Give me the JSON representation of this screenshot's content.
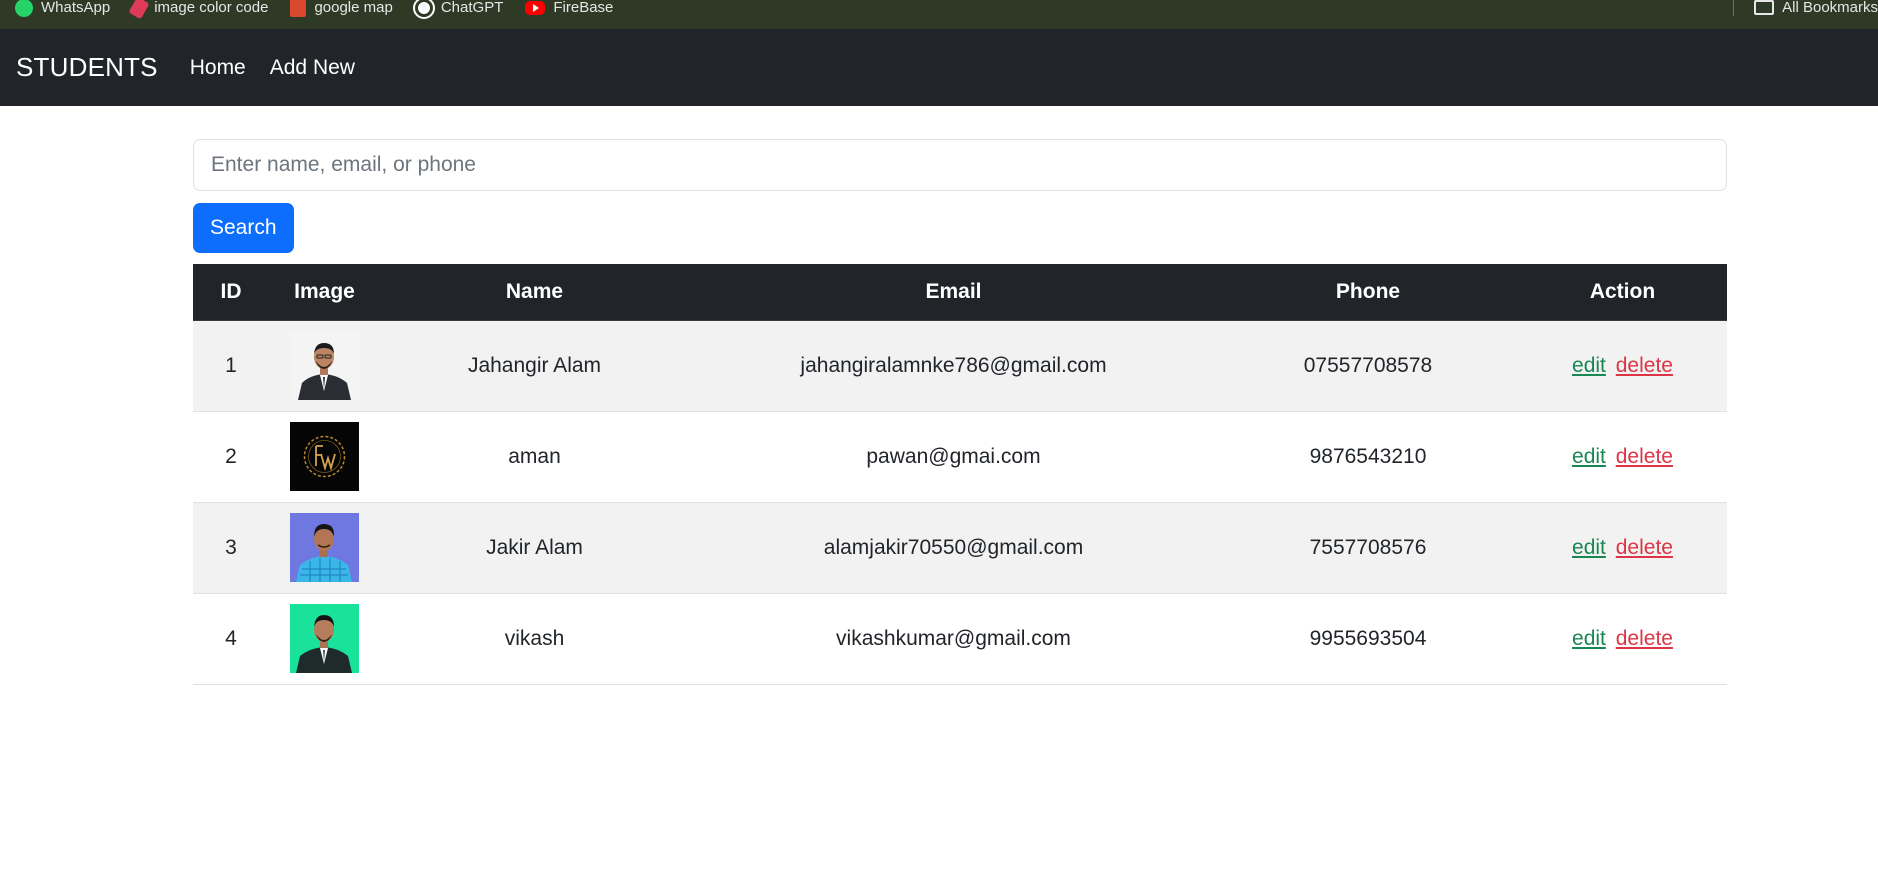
{
  "bookmarks": [
    {
      "label": "WhatsApp",
      "icon": "whatsapp-icon"
    },
    {
      "label": "image color code",
      "icon": "color-picker-icon"
    },
    {
      "label": "google map",
      "icon": "map-icon"
    },
    {
      "label": "ChatGPT",
      "icon": "chatgpt-icon"
    },
    {
      "label": "FireBase",
      "icon": "youtube-icon"
    }
  ],
  "bookmarks_right": {
    "label": "All Bookmarks",
    "icon": "folder-icon"
  },
  "navbar": {
    "brand": "STUDENTS",
    "links": [
      {
        "label": "Home"
      },
      {
        "label": "Add New"
      }
    ]
  },
  "search": {
    "placeholder": "Enter name, email, or phone",
    "value": "",
    "button_label": "Search"
  },
  "table": {
    "columns": [
      "ID",
      "Image",
      "Name",
      "Email",
      "Phone",
      "Action"
    ],
    "rows": [
      {
        "id": "1",
        "image": "photo of man in dark suit on white background",
        "name": "Jahangir Alam",
        "email": "jahangiralamnke786@gmail.com",
        "phone": "07557708578",
        "edit": "edit",
        "delete": "delete"
      },
      {
        "id": "2",
        "image": "black logo with golden circle and letters FW",
        "name": "aman",
        "email": "pawan@gmai.com",
        "phone": "9876543210",
        "edit": "edit",
        "delete": "delete"
      },
      {
        "id": "3",
        "image": "photo of man in checkered shirt on blue background",
        "name": "Jakir Alam",
        "email": "alamjakir70550@gmail.com",
        "phone": "7557708576",
        "edit": "edit",
        "delete": "delete"
      },
      {
        "id": "4",
        "image": "photo of man in dark suit on green background",
        "name": "vikash",
        "email": "vikashkumar@gmail.com",
        "phone": "9955693504",
        "edit": "edit",
        "delete": "delete"
      }
    ]
  },
  "colors": {
    "navbar_bg": "#212529",
    "bookmarks_bg": "#2e3a26",
    "primary": "#0d6efd",
    "edit": "#198754",
    "delete": "#dc3545",
    "row_stripe": "#f2f2f2"
  }
}
